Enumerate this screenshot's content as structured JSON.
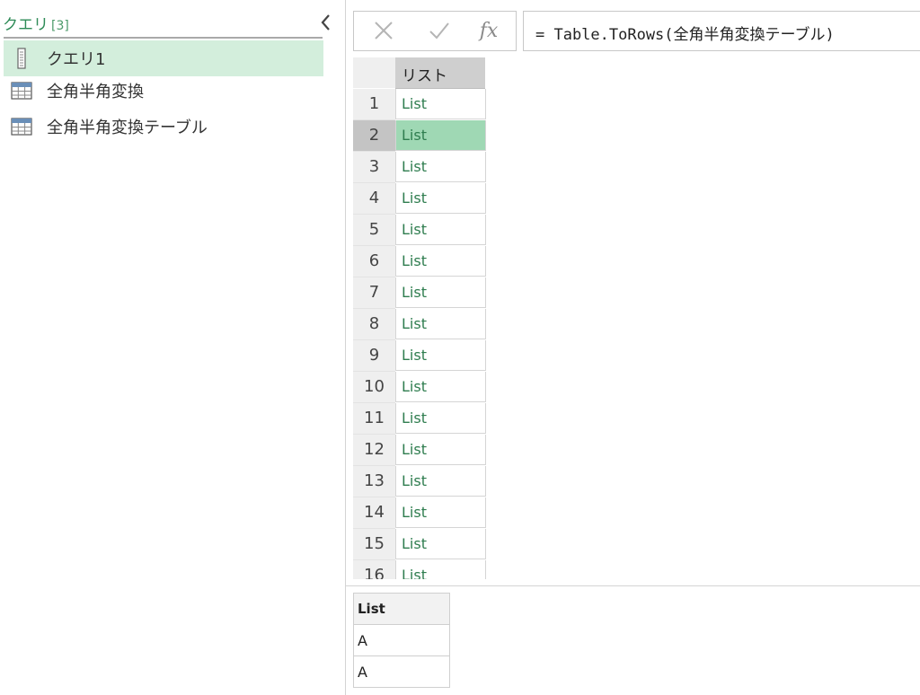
{
  "queries_pane": {
    "title": "クエリ",
    "count": "[3]",
    "items": [
      {
        "label": "クエリ1",
        "icon": "list-query-icon",
        "selected": true
      },
      {
        "label": "全角半角変換",
        "icon": "table-icon",
        "selected": false
      },
      {
        "label": "全角半角変換テーブル",
        "icon": "table-icon",
        "selected": false
      }
    ]
  },
  "formula_bar": {
    "fx_label": "fx",
    "formula": "= Table.ToRows(全角半角変換テーブル)"
  },
  "grid": {
    "column_header": "リスト",
    "selected_row": 2,
    "rows": [
      {
        "num": "1",
        "value": "List"
      },
      {
        "num": "2",
        "value": "List"
      },
      {
        "num": "3",
        "value": "List"
      },
      {
        "num": "4",
        "value": "List"
      },
      {
        "num": "5",
        "value": "List"
      },
      {
        "num": "6",
        "value": "List"
      },
      {
        "num": "7",
        "value": "List"
      },
      {
        "num": "8",
        "value": "List"
      },
      {
        "num": "9",
        "value": "List"
      },
      {
        "num": "10",
        "value": "List"
      },
      {
        "num": "11",
        "value": "List"
      },
      {
        "num": "12",
        "value": "List"
      },
      {
        "num": "13",
        "value": "List"
      },
      {
        "num": "14",
        "value": "List"
      },
      {
        "num": "15",
        "value": "List"
      },
      {
        "num": "16",
        "value": "List"
      }
    ]
  },
  "preview": {
    "header": "List",
    "values": [
      "A",
      "A"
    ]
  },
  "colors": {
    "accent_green": "#2e8b57",
    "selected_query_bg": "#d3eedc",
    "selected_cell_bg": "#9fd8b4",
    "list_link": "#2f7d4f"
  }
}
